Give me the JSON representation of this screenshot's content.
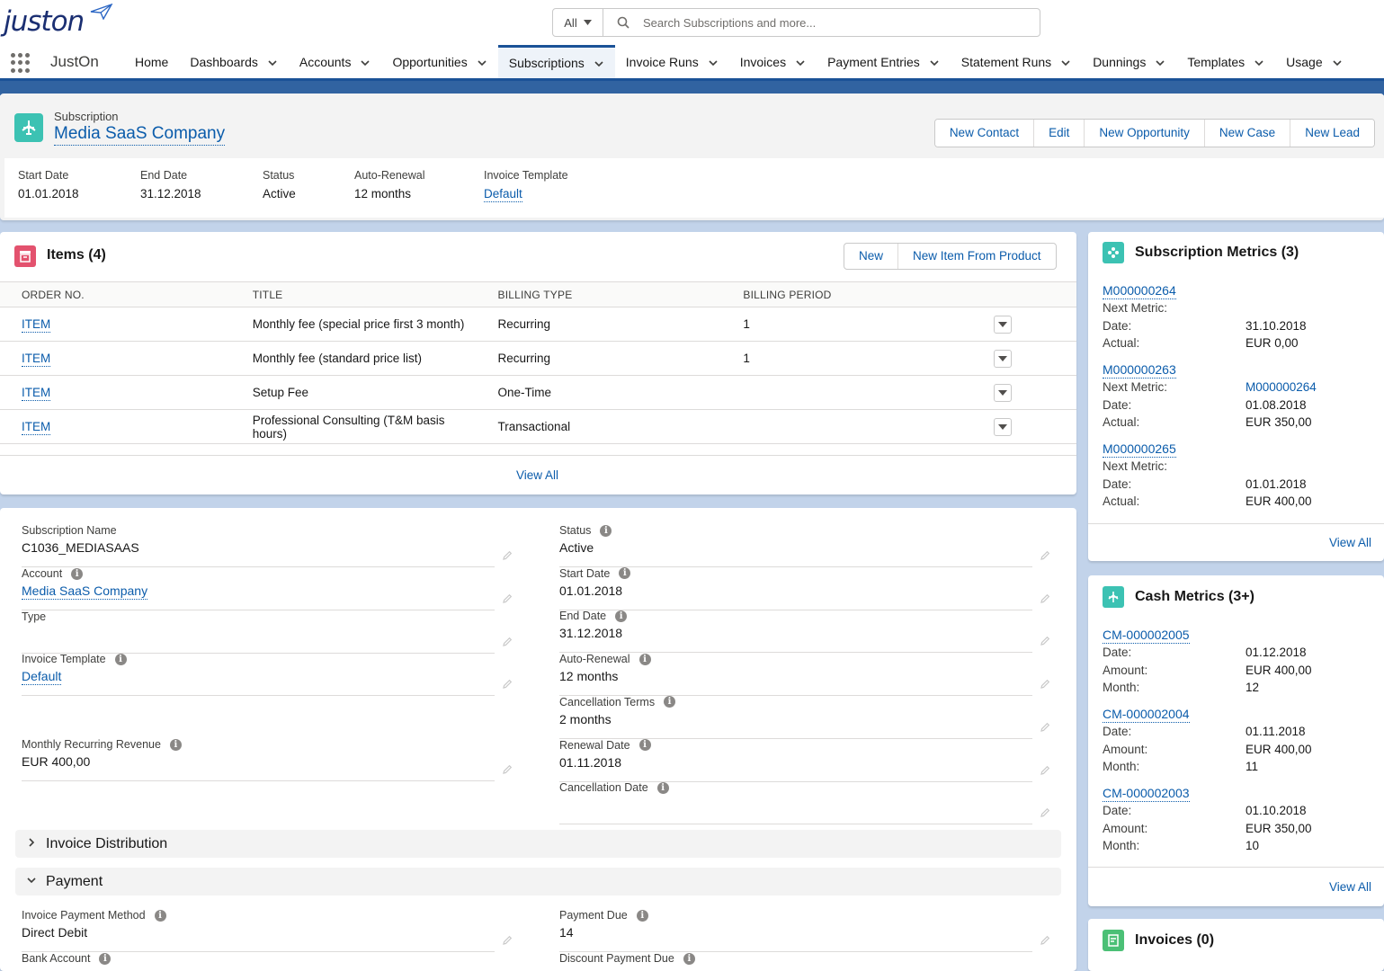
{
  "header": {
    "logo_text": "juston",
    "search": {
      "scope": "All",
      "placeholder": "Search Subscriptions and more..."
    }
  },
  "nav": {
    "app_name": "JustOn",
    "items": [
      {
        "label": "Home",
        "menu": false,
        "active": false
      },
      {
        "label": "Dashboards",
        "menu": true,
        "active": false
      },
      {
        "label": "Accounts",
        "menu": true,
        "active": false
      },
      {
        "label": "Opportunities",
        "menu": true,
        "active": false
      },
      {
        "label": "Subscriptions",
        "menu": true,
        "active": true
      },
      {
        "label": "Invoice Runs",
        "menu": true,
        "active": false
      },
      {
        "label": "Invoices",
        "menu": true,
        "active": false
      },
      {
        "label": "Payment Entries",
        "menu": true,
        "active": false
      },
      {
        "label": "Statement Runs",
        "menu": true,
        "active": false
      },
      {
        "label": "Dunnings",
        "menu": true,
        "active": false
      },
      {
        "label": "Templates",
        "menu": true,
        "active": false
      },
      {
        "label": "Usage",
        "menu": true,
        "active": false
      }
    ]
  },
  "record": {
    "object": "Subscription",
    "title": "Media SaaS Company",
    "actions": [
      "New Contact",
      "Edit",
      "New Opportunity",
      "New Case",
      "New Lead"
    ],
    "highlights": [
      {
        "label": "Start Date",
        "value": "01.01.2018",
        "link": false
      },
      {
        "label": "End Date",
        "value": "31.12.2018",
        "link": false
      },
      {
        "label": "Status",
        "value": "Active",
        "link": false
      },
      {
        "label": "Auto-Renewal",
        "value": "12 months",
        "link": false
      },
      {
        "label": "Invoice Template",
        "value": "Default",
        "link": true
      }
    ]
  },
  "items": {
    "title": "Items (4)",
    "buttons": [
      "New",
      "New Item From Product"
    ],
    "columns": [
      "ORDER NO.",
      "TITLE",
      "BILLING TYPE",
      "BILLING PERIOD"
    ],
    "rows": [
      {
        "order": "ITEM",
        "title": "Monthly fee (special price first 3 month)",
        "billing_type": "Recurring",
        "period": "1"
      },
      {
        "order": "ITEM",
        "title": "Monthly fee (standard price list)",
        "billing_type": "Recurring",
        "period": "1"
      },
      {
        "order": "ITEM",
        "title": "Setup Fee",
        "billing_type": "One-Time",
        "period": ""
      },
      {
        "order": "ITEM",
        "title": "Professional Consulting (T&M basis hours)",
        "billing_type": "Transactional",
        "period": ""
      }
    ],
    "view_all": "View All"
  },
  "details": {
    "left": [
      {
        "label": "Subscription Name",
        "value": "C1036_MEDIASAAS",
        "info": false,
        "link": false
      },
      {
        "label": "Account",
        "value": "Media SaaS Company",
        "info": true,
        "link": true
      },
      {
        "label": "Type",
        "value": "",
        "info": false,
        "link": false
      },
      {
        "label": "Invoice Template",
        "value": "Default",
        "info": true,
        "link": true
      },
      {
        "label": "Monthly Recurring Revenue",
        "value": "EUR 400,00",
        "info": true,
        "link": false
      }
    ],
    "right": [
      {
        "label": "Status",
        "value": "Active",
        "info": true
      },
      {
        "label": "Start Date",
        "value": "01.01.2018",
        "info": true
      },
      {
        "label": "End Date",
        "value": "31.12.2018",
        "info": true
      },
      {
        "label": "Auto-Renewal",
        "value": "12 months",
        "info": true
      },
      {
        "label": "Cancellation Terms",
        "value": "2 months",
        "info": true
      },
      {
        "label": "Renewal Date",
        "value": "01.11.2018",
        "info": true
      },
      {
        "label": "Cancellation Date",
        "value": "",
        "info": true
      }
    ],
    "sections": [
      {
        "label": "Invoice Distribution",
        "expanded": false
      },
      {
        "label": "Payment",
        "expanded": true
      }
    ],
    "payment_left": [
      {
        "label": "Invoice Payment Method",
        "value": "Direct Debit"
      },
      {
        "label": "Bank Account",
        "value": ""
      }
    ],
    "payment_right": [
      {
        "label": "Payment Due",
        "value": "14"
      },
      {
        "label": "Discount Payment Due",
        "value": ""
      }
    ]
  },
  "subscription_metrics": {
    "title": "Subscription Metrics (3)",
    "records": [
      {
        "id": "M000000264",
        "lines": [
          [
            "Next Metric:",
            ""
          ],
          [
            "Date:",
            "31.10.2018"
          ],
          [
            "Actual:",
            "EUR 0,00"
          ]
        ]
      },
      {
        "id": "M000000263",
        "lines": [
          [
            "Next Metric:",
            "M000000264"
          ],
          [
            "Date:",
            "01.08.2018"
          ],
          [
            "Actual:",
            "EUR 350,00"
          ]
        ]
      },
      {
        "id": "M000000265",
        "lines": [
          [
            "Next Metric:",
            ""
          ],
          [
            "Date:",
            "01.01.2018"
          ],
          [
            "Actual:",
            "EUR 400,00"
          ]
        ]
      }
    ],
    "view_all": "View All"
  },
  "cash_metrics": {
    "title": "Cash Metrics (3+)",
    "records": [
      {
        "id": "CM-000002005",
        "lines": [
          [
            "Date:",
            "01.12.2018"
          ],
          [
            "Amount:",
            "EUR 400,00"
          ],
          [
            "Month:",
            "12"
          ]
        ]
      },
      {
        "id": "CM-000002004",
        "lines": [
          [
            "Date:",
            "01.11.2018"
          ],
          [
            "Amount:",
            "EUR 400,00"
          ],
          [
            "Month:",
            "11"
          ]
        ]
      },
      {
        "id": "CM-000002003",
        "lines": [
          [
            "Date:",
            "01.10.2018"
          ],
          [
            "Amount:",
            "EUR 350,00"
          ],
          [
            "Month:",
            "10"
          ]
        ]
      }
    ],
    "view_all": "View All"
  },
  "invoices": {
    "title": "Invoices (0)"
  }
}
